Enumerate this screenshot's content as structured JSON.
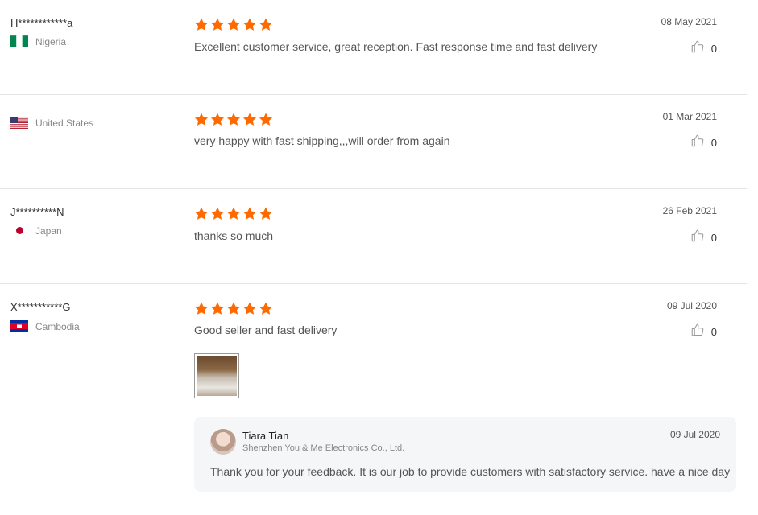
{
  "reviews": [
    {
      "user": "H************a",
      "country": "Nigeria",
      "flag_icon": "nigeria-flag-icon",
      "date": "08 May 2021",
      "text": "Excellent customer service, great reception. Fast response time and fast delivery",
      "likes": "0",
      "rating": 5
    },
    {
      "user": "",
      "country": "United States",
      "flag_icon": "united-states-flag-icon",
      "date": "01 Mar 2021",
      "text": "very happy with fast shipping,,,will order from again",
      "likes": "0",
      "rating": 5
    },
    {
      "user": "J**********N",
      "country": "Japan",
      "flag_icon": "japan-flag-icon",
      "date": "26 Feb 2021",
      "text": "thanks so much",
      "likes": "0",
      "rating": 5
    },
    {
      "user": "X***********G",
      "country": "Cambodia",
      "flag_icon": "cambodia-flag-icon",
      "date": "09 Jul 2020",
      "text": "Good seller and fast delivery",
      "likes": "0",
      "rating": 5
    }
  ],
  "reply": {
    "seller_name": "Tiara Tian",
    "company": "Shenzhen You & Me Electronics Co., Ltd.",
    "date": "09 Jul 2020",
    "text": "Thank you for your feedback. It is our job to provide customers with satisfactory service. have a nice day"
  },
  "colors": {
    "star": "#ff6a00",
    "divider": "#e5e5e5",
    "reply_bg": "#f5f6f7"
  }
}
